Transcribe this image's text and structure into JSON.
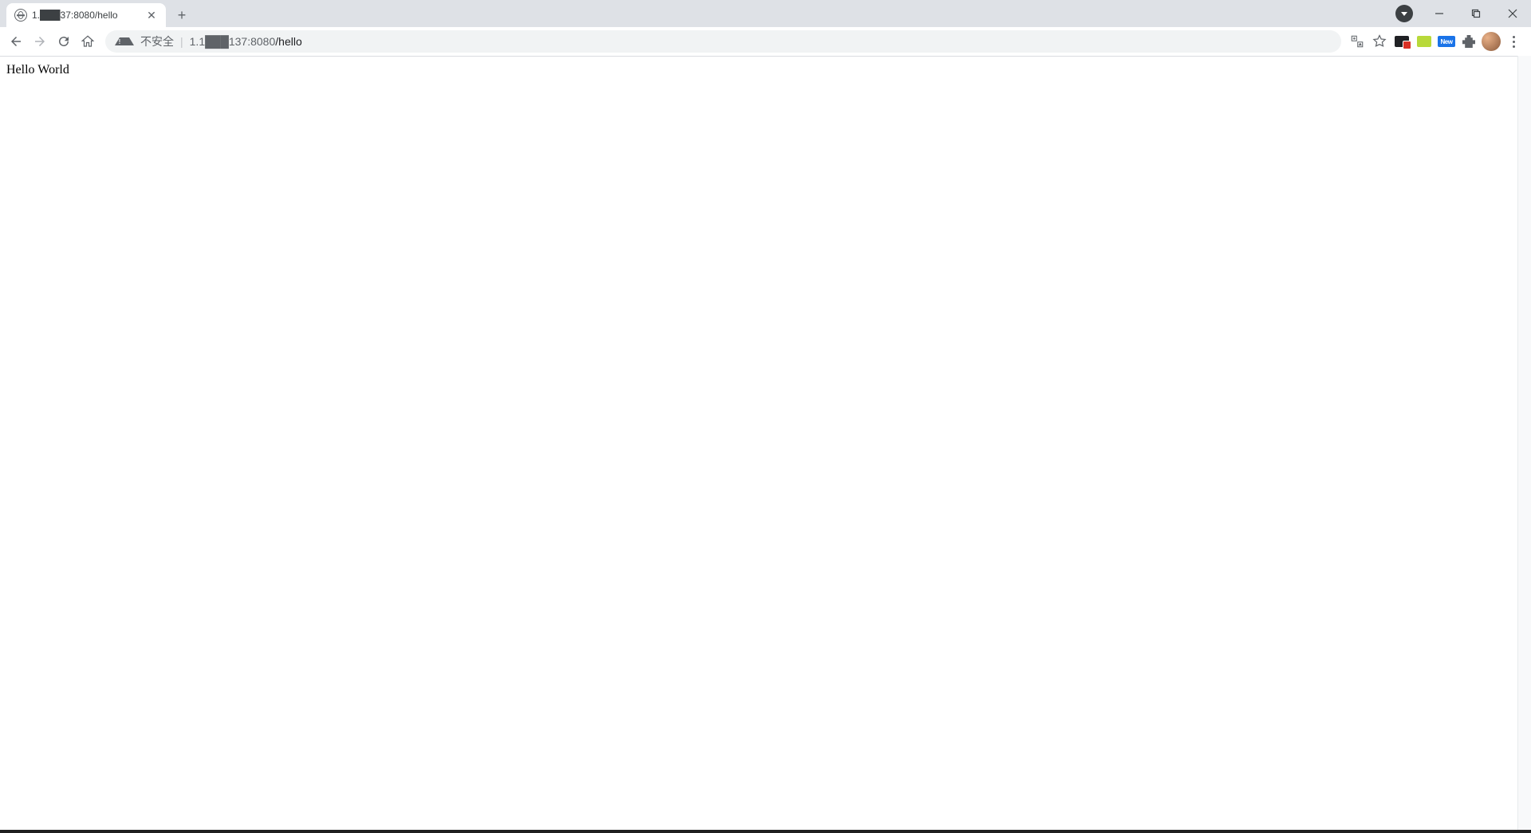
{
  "tab": {
    "title": "1.███37:8080/hello"
  },
  "toolbar": {
    "insecure_label": "不安全",
    "url_display_host": "1.1███137:8080",
    "url_display_path": "/hello"
  },
  "extensions": {
    "new_label": "New"
  },
  "page": {
    "body_text": "Hello World"
  }
}
